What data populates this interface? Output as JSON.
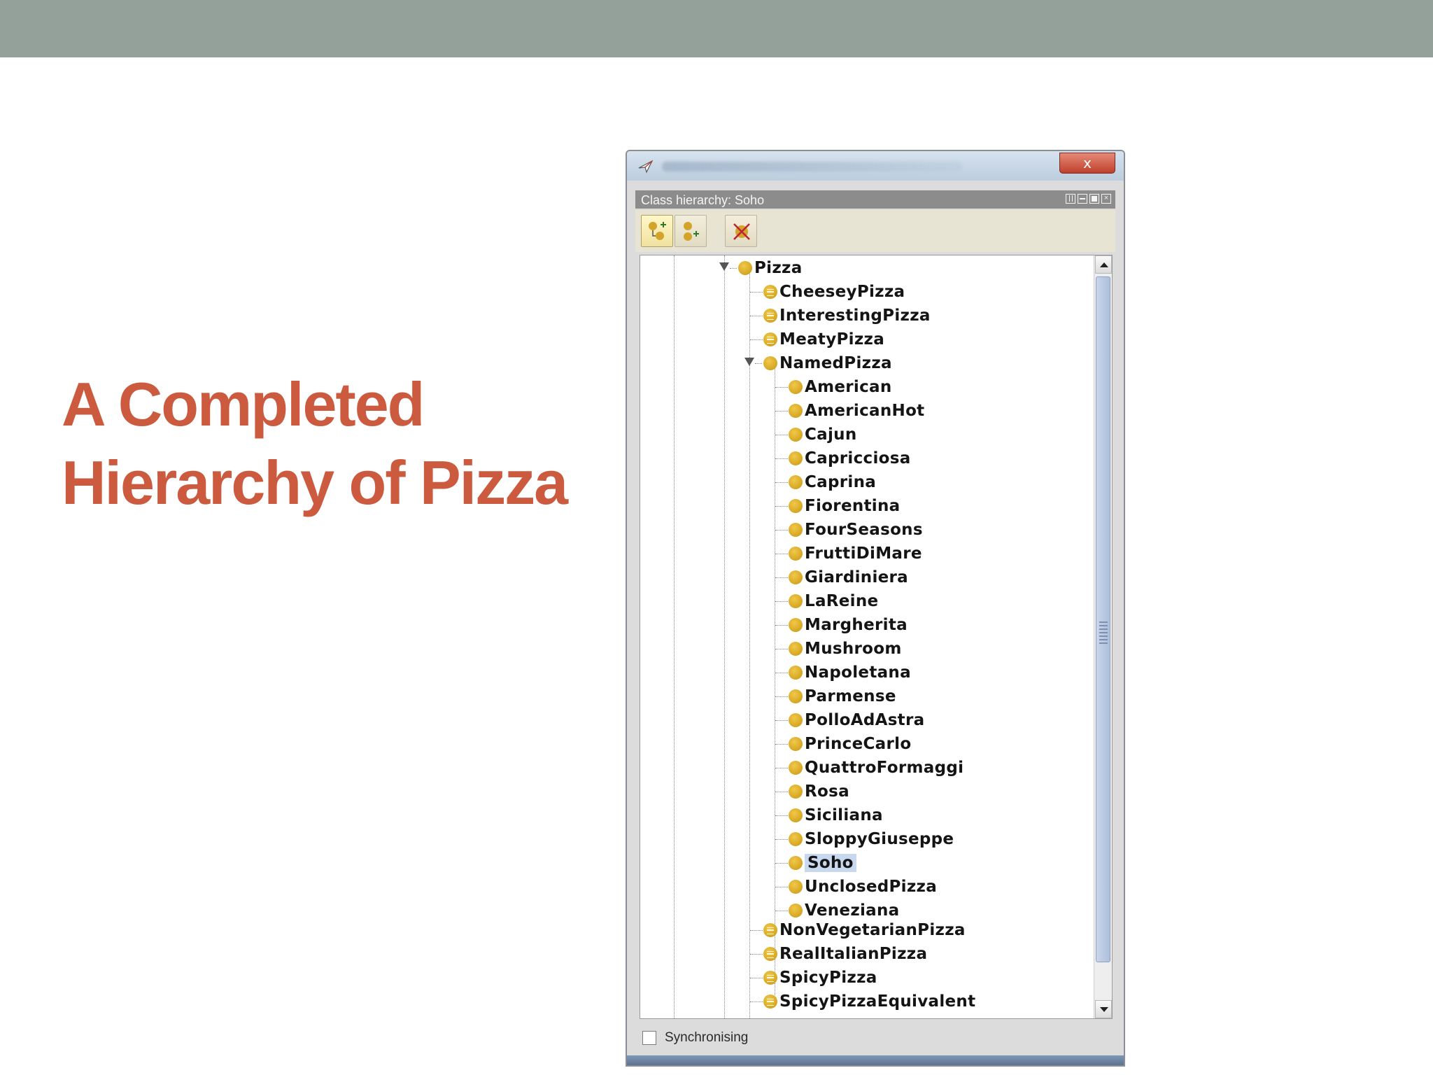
{
  "slide": {
    "title_line1": "A Completed",
    "title_line2": "Hierarchy of Pizza",
    "accent_color": "#cc5a3f",
    "band_color": "#93a19a"
  },
  "window": {
    "close_label": "x",
    "panel_title": "Class hierarchy: Soho",
    "toolbar": {
      "buttons": [
        {
          "icon": "add-subclass-icon",
          "active": true
        },
        {
          "icon": "add-sibling-class-icon",
          "active": false
        },
        {
          "icon": "delete-class-icon",
          "active": false
        }
      ]
    },
    "tree": {
      "root": "Pizza",
      "children": [
        {
          "label": "CheeseyPizza",
          "kind": "equivalent"
        },
        {
          "label": "InterestingPizza",
          "kind": "equivalent"
        },
        {
          "label": "MeatyPizza",
          "kind": "equivalent"
        },
        {
          "label": "NamedPizza",
          "kind": "primitive",
          "expanded": true
        },
        {
          "label": "NonVegetarianPizza",
          "kind": "equivalent"
        },
        {
          "label": "RealItalianPizza",
          "kind": "equivalent"
        },
        {
          "label": "SpicyPizza",
          "kind": "equivalent"
        },
        {
          "label": "SpicyPizzaEquivalent",
          "kind": "equivalent"
        }
      ],
      "named_pizzas": [
        "American",
        "AmericanHot",
        "Cajun",
        "Capricciosa",
        "Caprina",
        "Fiorentina",
        "FourSeasons",
        "FruttiDiMare",
        "Giardiniera",
        "LaReine",
        "Margherita",
        "Mushroom",
        "Napoletana",
        "Parmense",
        "PolloAdAstra",
        "PrinceCarlo",
        "QuattroFormaggi",
        "Rosa",
        "Siciliana",
        "SloppyGiuseppe",
        "Soho",
        "UnclosedPizza",
        "Veneziana"
      ],
      "selected": "Soho"
    },
    "sync_label": "Synchronising"
  }
}
